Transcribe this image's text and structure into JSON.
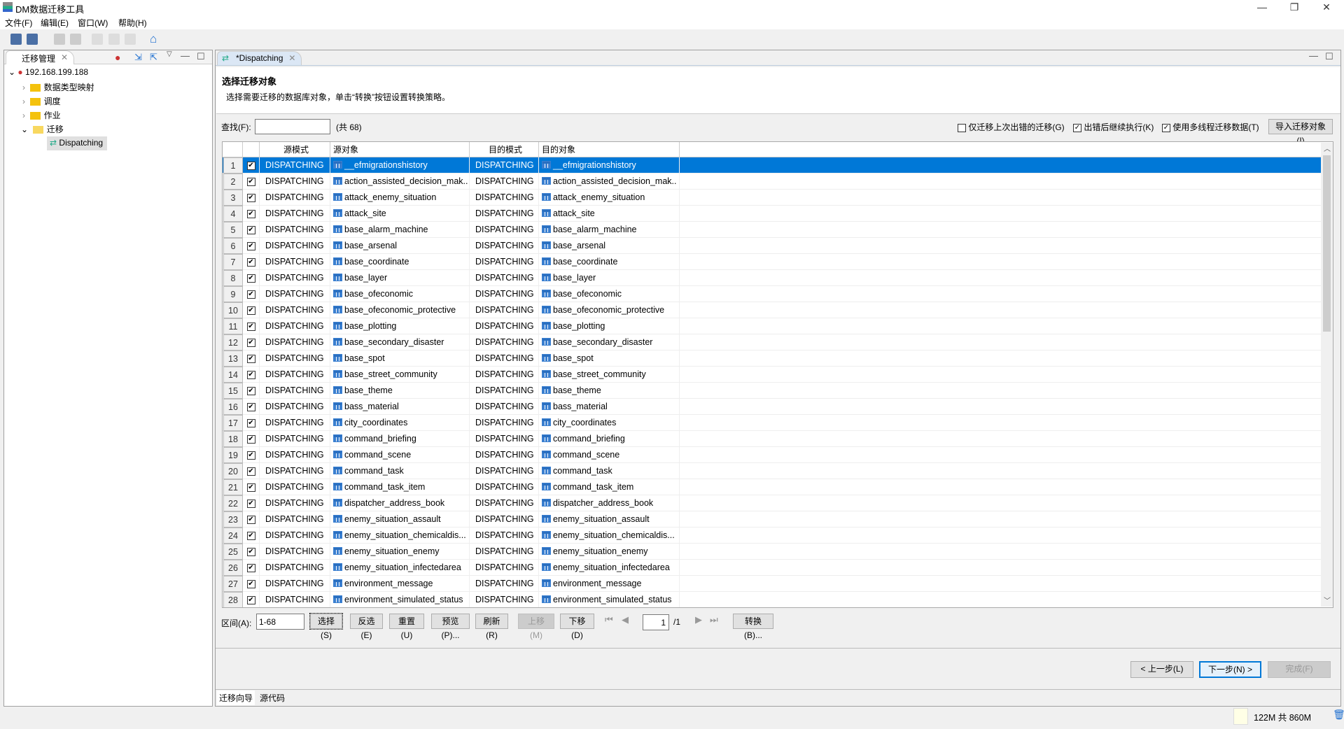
{
  "app": {
    "title": "DM数据迁移工具",
    "minimize": "—",
    "restore": "❐",
    "close": "✕"
  },
  "menu": [
    "文件(F)",
    "编辑(E)",
    "窗口(W)",
    "帮助(H)"
  ],
  "left": {
    "tab": "迁移管理",
    "tree": {
      "root": "192.168.199.188",
      "items": [
        "数据类型映射",
        "调度",
        "作业",
        "迁移"
      ],
      "child": "Dispatching"
    }
  },
  "editor": {
    "tab": "*Dispatching",
    "title": "选择迁移对象",
    "desc": "选择需要迁移的数据库对象，单击“转换”按钮设置转换策略。",
    "search_label": "查找(F):",
    "search_value": "",
    "count": "(共 68)",
    "options": [
      {
        "label": "仅迁移上次出错的迁移(G)",
        "checked": false
      },
      {
        "label": "出错后继续执行(K)",
        "checked": true
      },
      {
        "label": "使用多线程迁移数据(T)",
        "checked": true
      }
    ],
    "import_btn": "导入迁移对象(I)",
    "columns": [
      "源模式",
      "源对象",
      "目的模式",
      "目的对象"
    ],
    "rows": [
      [
        "DISPATCHING",
        "__efmigrationshistory",
        "DISPATCHING",
        "__efmigrationshistory"
      ],
      [
        "DISPATCHING",
        "action_assisted_decision_mak..",
        "DISPATCHING",
        "action_assisted_decision_mak.."
      ],
      [
        "DISPATCHING",
        "attack_enemy_situation",
        "DISPATCHING",
        "attack_enemy_situation"
      ],
      [
        "DISPATCHING",
        "attack_site",
        "DISPATCHING",
        "attack_site"
      ],
      [
        "DISPATCHING",
        "base_alarm_machine",
        "DISPATCHING",
        "base_alarm_machine"
      ],
      [
        "DISPATCHING",
        "base_arsenal",
        "DISPATCHING",
        "base_arsenal"
      ],
      [
        "DISPATCHING",
        "base_coordinate",
        "DISPATCHING",
        "base_coordinate"
      ],
      [
        "DISPATCHING",
        "base_layer",
        "DISPATCHING",
        "base_layer"
      ],
      [
        "DISPATCHING",
        "base_ofeconomic",
        "DISPATCHING",
        "base_ofeconomic"
      ],
      [
        "DISPATCHING",
        "base_ofeconomic_protective",
        "DISPATCHING",
        "base_ofeconomic_protective"
      ],
      [
        "DISPATCHING",
        "base_plotting",
        "DISPATCHING",
        "base_plotting"
      ],
      [
        "DISPATCHING",
        "base_secondary_disaster",
        "DISPATCHING",
        "base_secondary_disaster"
      ],
      [
        "DISPATCHING",
        "base_spot",
        "DISPATCHING",
        "base_spot"
      ],
      [
        "DISPATCHING",
        "base_street_community",
        "DISPATCHING",
        "base_street_community"
      ],
      [
        "DISPATCHING",
        "base_theme",
        "DISPATCHING",
        "base_theme"
      ],
      [
        "DISPATCHING",
        "bass_material",
        "DISPATCHING",
        "bass_material"
      ],
      [
        "DISPATCHING",
        "city_coordinates",
        "DISPATCHING",
        "city_coordinates"
      ],
      [
        "DISPATCHING",
        "command_briefing",
        "DISPATCHING",
        "command_briefing"
      ],
      [
        "DISPATCHING",
        "command_scene",
        "DISPATCHING",
        "command_scene"
      ],
      [
        "DISPATCHING",
        "command_task",
        "DISPATCHING",
        "command_task"
      ],
      [
        "DISPATCHING",
        "command_task_item",
        "DISPATCHING",
        "command_task_item"
      ],
      [
        "DISPATCHING",
        "dispatcher_address_book",
        "DISPATCHING",
        "dispatcher_address_book"
      ],
      [
        "DISPATCHING",
        "enemy_situation_assault",
        "DISPATCHING",
        "enemy_situation_assault"
      ],
      [
        "DISPATCHING",
        "enemy_situation_chemicaldis...",
        "DISPATCHING",
        "enemy_situation_chemicaldis..."
      ],
      [
        "DISPATCHING",
        "enemy_situation_enemy",
        "DISPATCHING",
        "enemy_situation_enemy"
      ],
      [
        "DISPATCHING",
        "enemy_situation_infectedarea",
        "DISPATCHING",
        "enemy_situation_infectedarea"
      ],
      [
        "DISPATCHING",
        "environment_message",
        "DISPATCHING",
        "environment_message"
      ],
      [
        "DISPATCHING",
        "environment_simulated_status",
        "DISPATCHING",
        "environment_simulated_status"
      ]
    ],
    "range_label": "区间(A):",
    "range_value": "1-68",
    "actions": [
      {
        "label": "选择(S)",
        "enabled": true
      },
      {
        "label": "反选(E)",
        "enabled": true
      },
      {
        "label": "重置(U)",
        "enabled": true
      },
      {
        "label": "预览(P)...",
        "enabled": true
      },
      {
        "label": "刷新(R)",
        "enabled": true
      },
      {
        "label": "上移(M)",
        "enabled": false
      },
      {
        "label": "下移(D)",
        "enabled": true
      }
    ],
    "page_value": "1",
    "page_total": "/1",
    "convert_btn": "转换(B)...",
    "prev_btn": "< 上一步(L)",
    "next_btn": "下一步(N) >",
    "finish_btn": "完成(F)",
    "bottom_tabs": [
      "迁移向导",
      "源代码"
    ]
  },
  "status": {
    "memory": "122M 共 860M"
  },
  "colors": {
    "selection": "#0078d7",
    "folder": "#f4c20d"
  }
}
